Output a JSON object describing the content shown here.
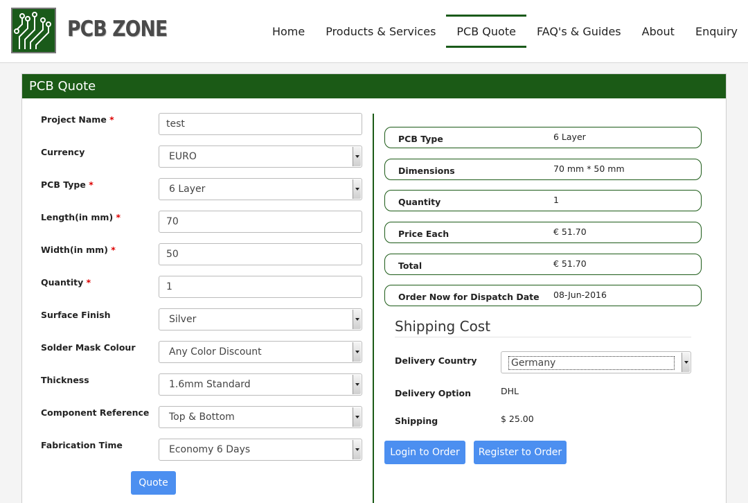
{
  "brand": {
    "name": "PCB ZONE",
    "logo_color": "#1a5a1a"
  },
  "nav": {
    "items": [
      {
        "label": "Home",
        "active": false
      },
      {
        "label": "Products & Services",
        "active": false
      },
      {
        "label": "PCB Quote",
        "active": true
      },
      {
        "label": "FAQ's & Guides",
        "active": false
      },
      {
        "label": "About",
        "active": false
      },
      {
        "label": "Enquiry",
        "active": false
      }
    ]
  },
  "panel": {
    "title": "PCB Quote",
    "accent": "#1b5a16"
  },
  "form": {
    "fields": [
      {
        "label": "Project Name",
        "required": true,
        "type": "input",
        "value": "test"
      },
      {
        "label": "Currency",
        "required": false,
        "type": "select",
        "value": "EURO"
      },
      {
        "label": "PCB Type",
        "required": true,
        "type": "select",
        "value": "6 Layer"
      },
      {
        "label": "Length(in mm)",
        "required": true,
        "type": "input",
        "value": "70"
      },
      {
        "label": "Width(in mm)",
        "required": true,
        "type": "input",
        "value": "50"
      },
      {
        "label": "Quantity",
        "required": true,
        "type": "input",
        "value": "1"
      },
      {
        "label": "Surface Finish",
        "required": false,
        "type": "select",
        "value": "Silver"
      },
      {
        "label": "Solder Mask Colour",
        "required": false,
        "type": "select",
        "value": "Any Color Discount"
      },
      {
        "label": "Thickness",
        "required": false,
        "type": "select",
        "value": "1.6mm Standard"
      },
      {
        "label": "Component Reference",
        "required": false,
        "type": "select",
        "value": "Top & Bottom"
      },
      {
        "label": "Fabrication Time",
        "required": false,
        "type": "select",
        "value": "Economy 6 Days"
      }
    ],
    "required_mark": "*",
    "quote_button": "Quote"
  },
  "summary": {
    "rows": [
      {
        "label": "PCB Type",
        "value": "6 Layer"
      },
      {
        "label": "Dimensions",
        "value": "70 mm * 50 mm"
      },
      {
        "label": "Quantity",
        "value": "1"
      },
      {
        "label": "Price Each",
        "value": "€ 51.70"
      },
      {
        "label": "Total",
        "value": "€ 51.70"
      },
      {
        "label": "Order Now for Dispatch Date",
        "value": "08-Jun-2016"
      }
    ]
  },
  "shipping": {
    "title": "Shipping Cost",
    "country_label": "Delivery Country",
    "country_value": "Germany",
    "option_label": "Delivery Option",
    "option_value": "DHL",
    "cost_label": "Shipping",
    "cost_value": "$ 25.00"
  },
  "actions": {
    "login": "Login to Order",
    "register": "Register to Order",
    "button_color": "#4c8ff0"
  }
}
